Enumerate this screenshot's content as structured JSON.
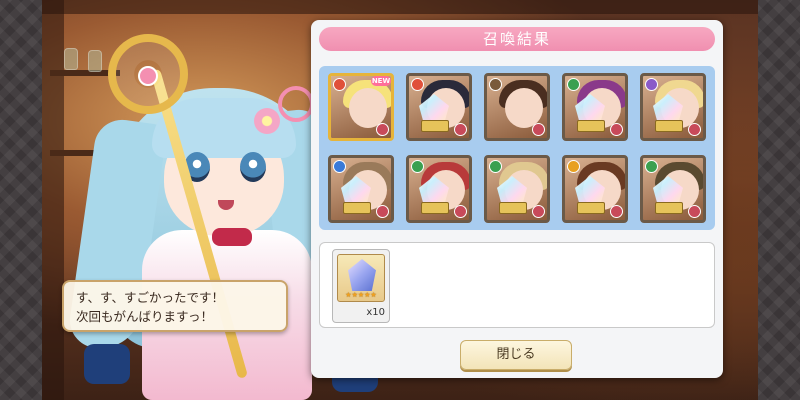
{
  "dialogue": {
    "line1": "す、す、すごかったです！",
    "line2": "次回もがんばりますっ！"
  },
  "panel": {
    "title": "召喚結果",
    "close_label": "閉じる"
  },
  "results": [
    {
      "element": "fire",
      "element_color": "#e0503a",
      "hair_color": "#f6e27a",
      "frame": "gold",
      "new": true,
      "new_label": "NEW",
      "crystal": false
    },
    {
      "element": "fire",
      "element_color": "#e0503a",
      "hair_color": "#2a2a3a",
      "frame": "bronze",
      "new": false,
      "crystal": true
    },
    {
      "element": "earth",
      "element_color": "#7a5a3a",
      "hair_color": "#4a2e20",
      "frame": "bronze",
      "new": false,
      "crystal": false
    },
    {
      "element": "wind",
      "element_color": "#3aa050",
      "hair_color": "#8a3a8a",
      "frame": "bronze",
      "new": false,
      "crystal": true
    },
    {
      "element": "moon",
      "element_color": "#8a5ac8",
      "hair_color": "#f0d890",
      "frame": "bronze",
      "new": false,
      "crystal": true
    },
    {
      "element": "water",
      "element_color": "#3a7ad8",
      "hair_color": "#9a7a5a",
      "frame": "bronze",
      "new": false,
      "crystal": true
    },
    {
      "element": "wind",
      "element_color": "#3aa050",
      "hair_color": "#b83a3a",
      "frame": "bronze",
      "new": false,
      "crystal": true
    },
    {
      "element": "wind",
      "element_color": "#3aa050",
      "hair_color": "#e0c890",
      "frame": "bronze",
      "new": false,
      "crystal": true
    },
    {
      "element": "sun",
      "element_color": "#e8a020",
      "hair_color": "#6a3a22",
      "frame": "bronze",
      "new": false,
      "crystal": true
    },
    {
      "element": "wind",
      "element_color": "#3aa050",
      "hair_color": "#5a4a30",
      "frame": "bronze",
      "new": false,
      "crystal": true
    }
  ],
  "items": [
    {
      "name_icon": "crystal-item-icon",
      "stars": "★★★★★",
      "count": "x10"
    }
  ]
}
